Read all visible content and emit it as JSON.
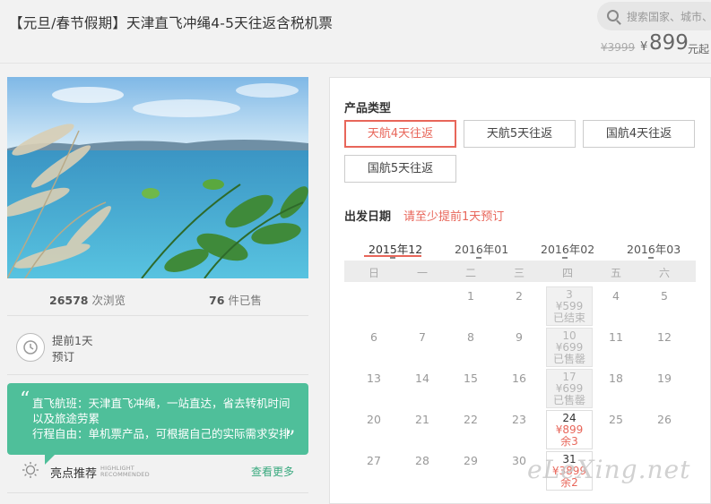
{
  "product": {
    "title": "【元旦/春节假期】天津直飞冲绳4-5天往返含税机票"
  },
  "search": {
    "placeholder": "搜索国家、城市、"
  },
  "price": {
    "original": "¥3999",
    "currency": "¥",
    "current": "899",
    "unit": "元起"
  },
  "stats": {
    "views_count": "26578",
    "views_label": "次浏览",
    "sold_count": "76",
    "sold_label": "件已售"
  },
  "booking": {
    "line1": "提前1天",
    "line2": "预订"
  },
  "highlights": {
    "open_quote": "“",
    "close_quote": "”",
    "line1": "直飞航班：天津直飞冲绳，一站直达，省去转机时间",
    "line2": "以及旅途劳累",
    "line3": "行程自由：单机票产品，可根据自己的实际需求安排",
    "title": "亮点推荐",
    "title_en_1": "HIGHLIGHT",
    "title_en_2": "RECOMMENDED",
    "more": "查看更多"
  },
  "product_type": {
    "label": "产品类型",
    "options": [
      "天航4天往返",
      "天航5天往返",
      "国航4天往返",
      "国航5天往返"
    ]
  },
  "departure": {
    "label": "出发日期",
    "notice": "请至少提前1天预订"
  },
  "calendar": {
    "months": [
      "2015年12",
      "2016年01",
      "2016年02",
      "2016年03"
    ],
    "weekdays": [
      "日",
      "一",
      "二",
      "三",
      "四",
      "五",
      "六"
    ],
    "days": {
      "d1": "1",
      "d2": "2",
      "d3": "3",
      "d4": "4",
      "d5": "5",
      "d6": "6",
      "d7": "7",
      "d8": "8",
      "d9": "9",
      "d10": "10",
      "d11": "11",
      "d12": "12",
      "d13": "13",
      "d14": "14",
      "d15": "15",
      "d16": "16",
      "d17": "17",
      "d18": "18",
      "d19": "19",
      "d20": "20",
      "d21": "21",
      "d22": "22",
      "d23": "23",
      "d24": "24",
      "d25": "25",
      "d26": "26",
      "d27": "27",
      "d28": "28",
      "d29": "29",
      "d30": "30",
      "d31": "31"
    },
    "special": {
      "d3": {
        "price": "¥599",
        "status": "已结束"
      },
      "d10": {
        "price": "¥699",
        "status": "已售罄"
      },
      "d17": {
        "price": "¥699",
        "status": "已售罄"
      },
      "d24": {
        "price": "¥899",
        "status": "余3"
      },
      "d31": {
        "price": "¥3899",
        "status": "余2"
      }
    }
  },
  "watermark": "eLeXing.net",
  "colors": {
    "accent": "#e8665a",
    "green": "#4fbf9a",
    "link_green": "#3aa97f"
  }
}
